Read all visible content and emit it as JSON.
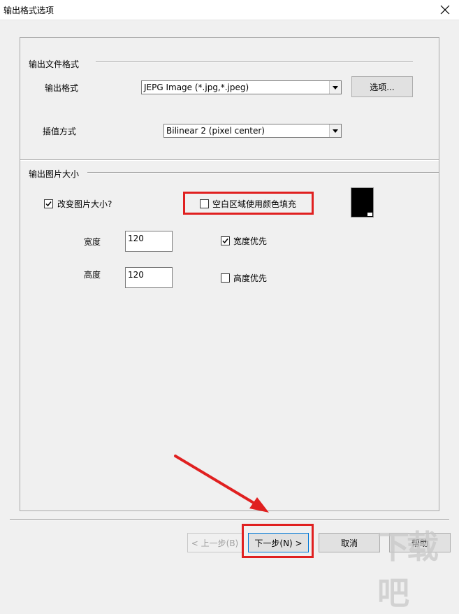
{
  "window": {
    "title": "输出格式选项"
  },
  "output_file_format": {
    "section_title": "输出文件格式",
    "format_label": "输出格式",
    "format_value": "JEPG Image (*.jpg,*.jpeg)",
    "options_button": "选项...",
    "interp_label": "插值方式",
    "interp_value": "Bilinear 2 (pixel center)"
  },
  "output_size": {
    "section_title": "输出图片大小",
    "resize_label": "改变图片大小?",
    "resize_checked": true,
    "fill_label": "空白区域使用颜色填充",
    "fill_checked": false,
    "fill_color": "#000000",
    "width_label": "宽度",
    "width_value": "120",
    "width_priority_label": "宽度优先",
    "width_priority_checked": true,
    "height_label": "高度",
    "height_value": "120",
    "height_priority_label": "高度优先",
    "height_priority_checked": false
  },
  "footer": {
    "back_button": "< 上一步(B)",
    "next_button": "下一步(N) >",
    "cancel_button": "取消",
    "help_button": "帮助"
  },
  "watermark": "下载吧",
  "annotation_color": "#e02020"
}
